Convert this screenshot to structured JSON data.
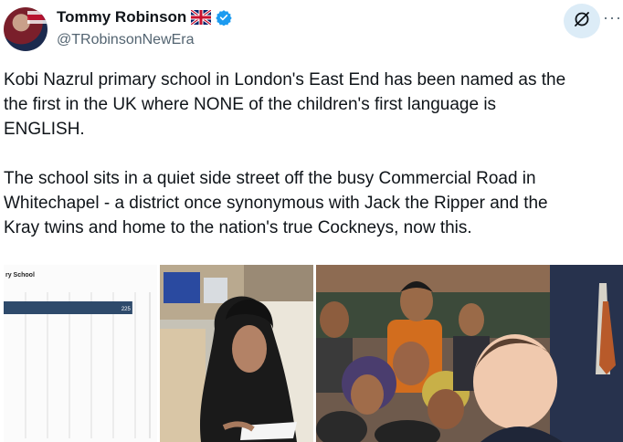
{
  "author": {
    "name": "Tommy Robinson",
    "handle": "@TRobinsonNewEra",
    "flag": "uk-flag-icon",
    "verified": "verified-badge-icon"
  },
  "actions": {
    "grok": "grok-icon",
    "more": "···"
  },
  "tweet": {
    "paragraph1": "Kobi Nazrul primary school in London's East End has been named as the\nthe first in the UK where NONE of the children's first language is\nENGLISH.",
    "paragraph2": "The school sits in a quiet side street off the busy Commercial Road in\nWhitechapel - a district once synonymous with Jack the Ripper and the\nKray twins and home to the nation's true Cockneys, now this."
  },
  "media": {
    "chart_title": "ry School",
    "images": [
      "student-in-hijab-photo",
      "children-with-man-photo"
    ]
  },
  "chart_data": {
    "type": "bar",
    "title": "ry School",
    "categories": [
      ""
    ],
    "values": [
      225
    ],
    "xlim": [
      0,
      230
    ],
    "grid": true,
    "orientation": "horizontal"
  },
  "colors": {
    "verified": "#1d9bf0",
    "bar": "#2e4a6b",
    "handle": "#536471"
  }
}
